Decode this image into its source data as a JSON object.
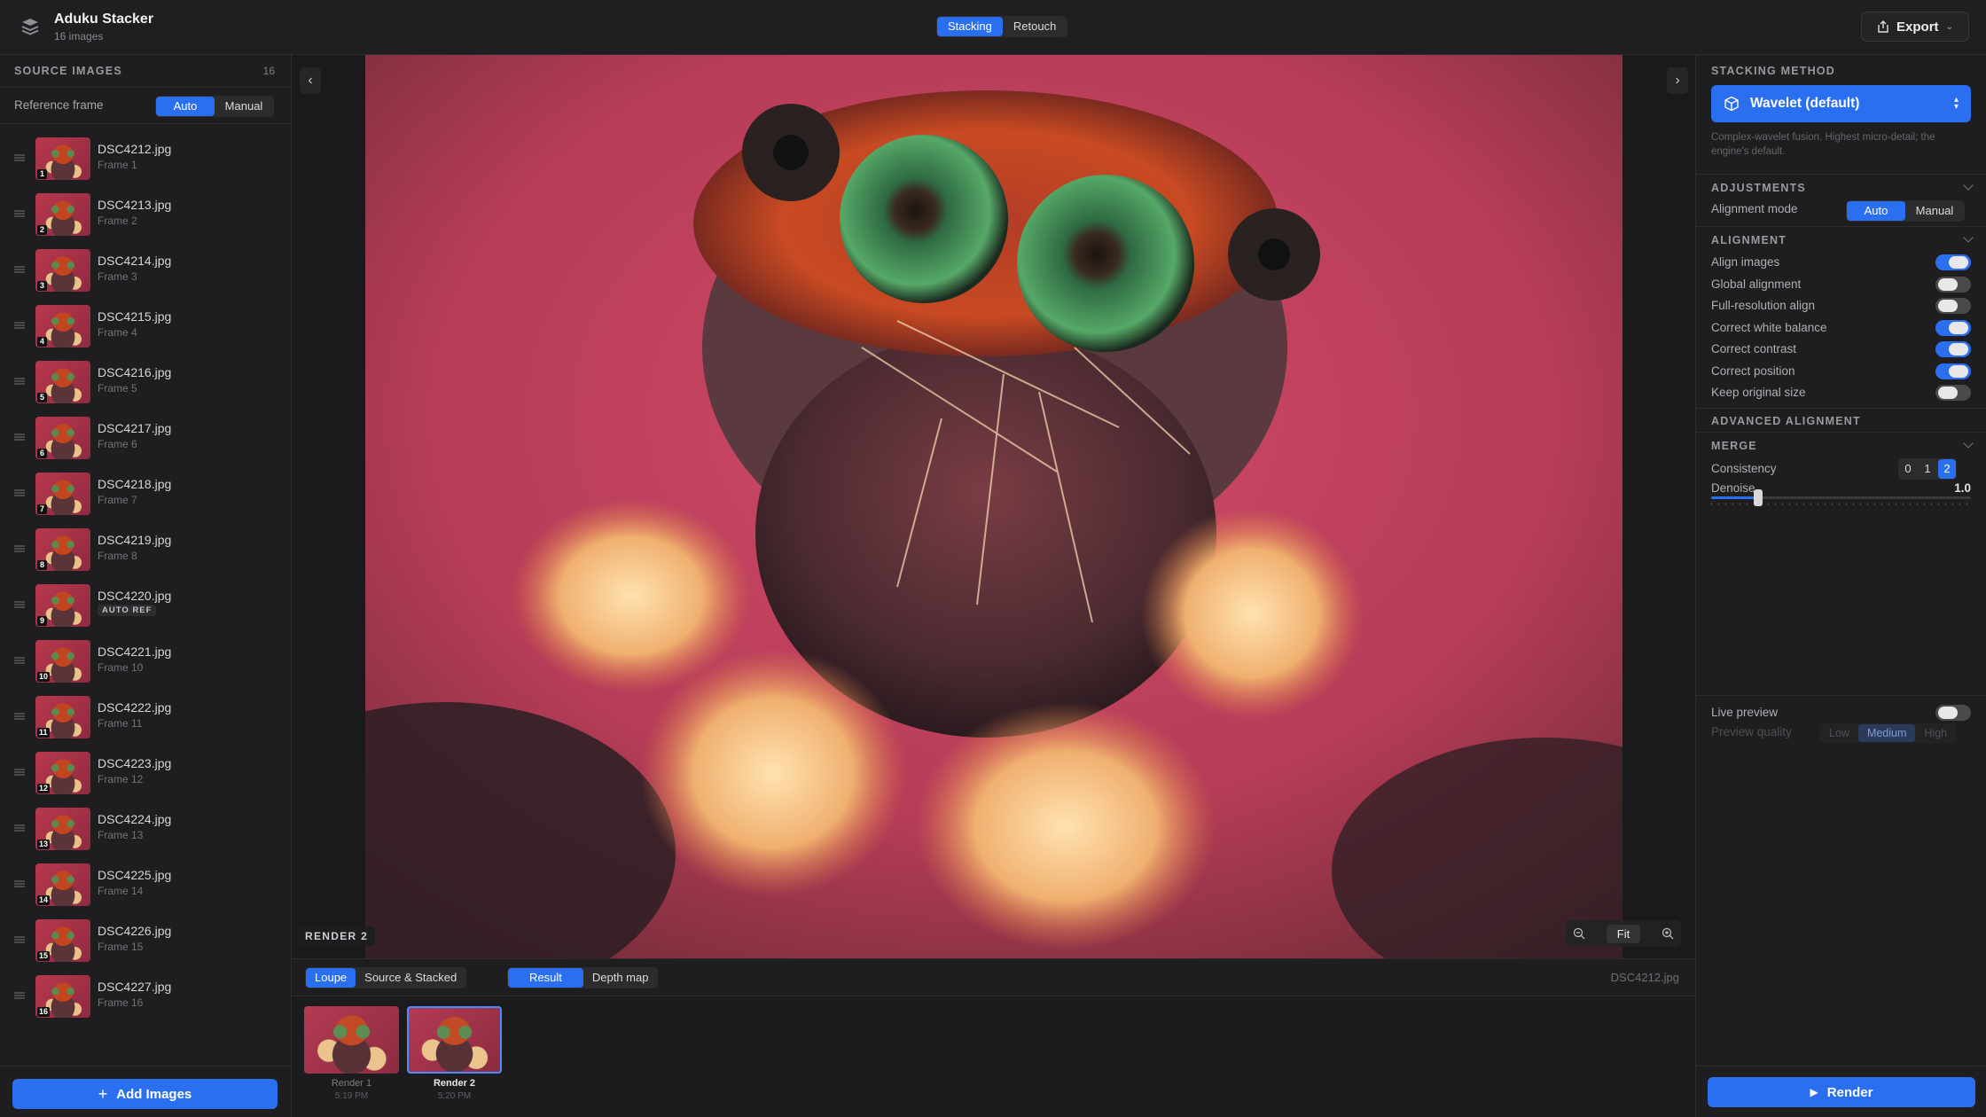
{
  "header": {
    "app_name": "Aduku Stacker",
    "image_count_text": "16 images",
    "mode_tabs": [
      {
        "label": "Stacking",
        "active": true
      },
      {
        "label": "Retouch",
        "active": false
      }
    ],
    "export_label": "Export"
  },
  "source_panel": {
    "title": "SOURCE IMAGES",
    "count": "16",
    "reference_frame_label": "Reference frame",
    "reference_options": [
      {
        "label": "Auto",
        "active": true
      },
      {
        "label": "Manual",
        "active": false
      }
    ],
    "images": [
      {
        "num": "1",
        "name": "DSC4212.jpg",
        "sub": "Frame 1"
      },
      {
        "num": "2",
        "name": "DSC4213.jpg",
        "sub": "Frame 2"
      },
      {
        "num": "3",
        "name": "DSC4214.jpg",
        "sub": "Frame 3"
      },
      {
        "num": "4",
        "name": "DSC4215.jpg",
        "sub": "Frame 4"
      },
      {
        "num": "5",
        "name": "DSC4216.jpg",
        "sub": "Frame 5"
      },
      {
        "num": "6",
        "name": "DSC4217.jpg",
        "sub": "Frame 6"
      },
      {
        "num": "7",
        "name": "DSC4218.jpg",
        "sub": "Frame 7"
      },
      {
        "num": "8",
        "name": "DSC4219.jpg",
        "sub": "Frame 8"
      },
      {
        "num": "9",
        "name": "DSC4220.jpg",
        "badge": "AUTO REF"
      },
      {
        "num": "10",
        "name": "DSC4221.jpg",
        "sub": "Frame 10"
      },
      {
        "num": "11",
        "name": "DSC4222.jpg",
        "sub": "Frame 11"
      },
      {
        "num": "12",
        "name": "DSC4223.jpg",
        "sub": "Frame 12"
      },
      {
        "num": "13",
        "name": "DSC4224.jpg",
        "sub": "Frame 13"
      },
      {
        "num": "14",
        "name": "DSC4225.jpg",
        "sub": "Frame 14"
      },
      {
        "num": "15",
        "name": "DSC4226.jpg",
        "sub": "Frame 15"
      },
      {
        "num": "16",
        "name": "DSC4227.jpg",
        "sub": "Frame 16"
      }
    ],
    "add_images_label": "Add Images"
  },
  "viewer": {
    "render_tag": "RENDER 2",
    "zoom_label": "Fit",
    "view_modes": [
      {
        "label": "Loupe",
        "active": true
      },
      {
        "label": "Source & Stacked",
        "active": false
      }
    ],
    "result_modes": [
      {
        "label": "Result",
        "active": true
      },
      {
        "label": "Depth map",
        "active": false
      }
    ],
    "current_file": "DSC4212.jpg",
    "renders": [
      {
        "label": "Render 1",
        "time": "5:19 PM",
        "selected": false
      },
      {
        "label": "Render 2",
        "time": "5:20 PM",
        "selected": true
      }
    ]
  },
  "settings": {
    "stacking_method_title": "STACKING METHOD",
    "method_label": "Wavelet (default)",
    "method_desc": "Complex-wavelet fusion. Highest micro-detail; the engine's default.",
    "adjustments_title": "ADJUSTMENTS",
    "alignment_mode_label": "Alignment mode",
    "alignment_mode_options": [
      {
        "label": "Auto",
        "active": true
      },
      {
        "label": "Manual",
        "active": false
      }
    ],
    "alignment_title": "ALIGNMENT",
    "alignment_toggles": [
      {
        "label": "Align images",
        "on": true
      },
      {
        "label": "Global alignment",
        "on": false
      },
      {
        "label": "Full-resolution align",
        "on": false
      },
      {
        "label": "Correct white balance",
        "on": true
      },
      {
        "label": "Correct contrast",
        "on": true
      },
      {
        "label": "Correct position",
        "on": true
      },
      {
        "label": "Keep original size",
        "on": false
      }
    ],
    "advanced_alignment_title": "ADVANCED ALIGNMENT",
    "merge_title": "MERGE",
    "consistency_label": "Consistency",
    "consistency_options": [
      {
        "label": "0",
        "active": false
      },
      {
        "label": "1",
        "active": false
      },
      {
        "label": "2",
        "active": true
      }
    ],
    "denoise_label": "Denoise",
    "denoise_value": "1.0",
    "denoise_fraction": 0.18,
    "live_preview_label": "Live preview",
    "live_preview_on": false,
    "preview_quality_label": "Preview quality",
    "preview_quality_options": [
      {
        "label": "Low",
        "active": false
      },
      {
        "label": "Medium",
        "active": true
      },
      {
        "label": "High",
        "active": false
      }
    ],
    "render_label": "Render"
  },
  "colors": {
    "accent": "#2a6ff0",
    "panel_bg": "#1e1e20"
  }
}
